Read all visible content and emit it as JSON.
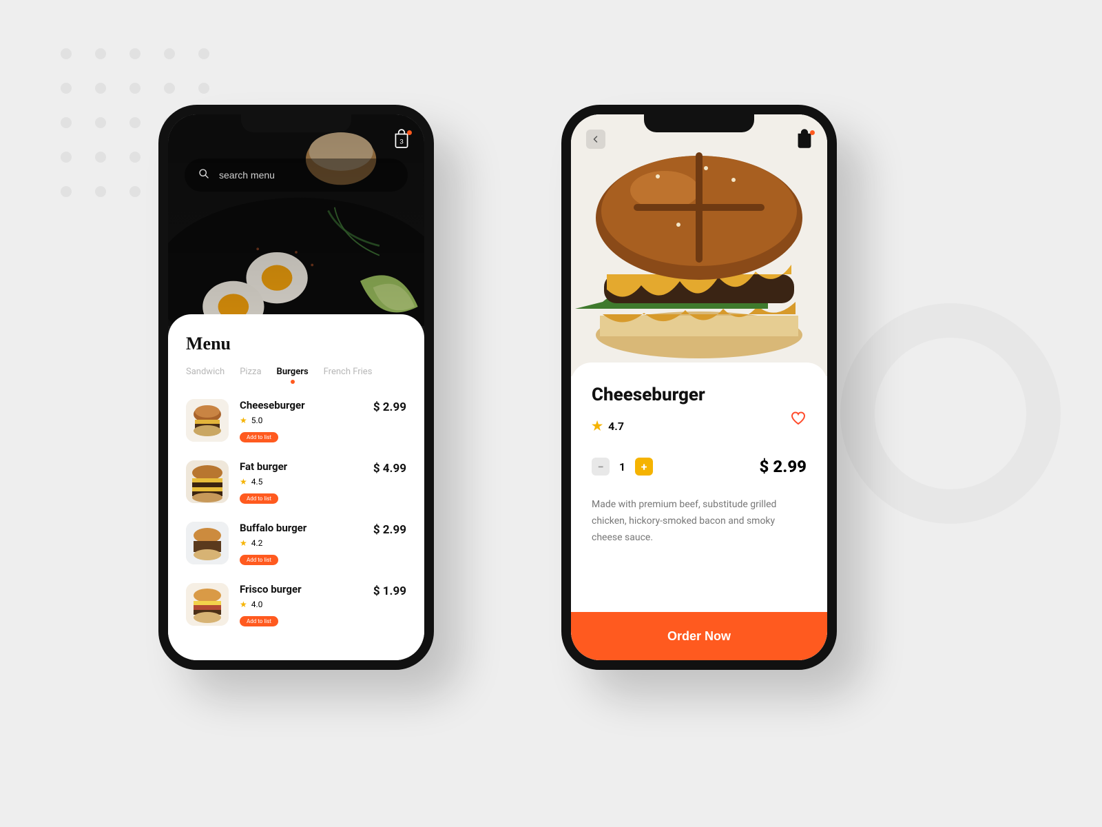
{
  "cart": {
    "count": "3"
  },
  "menu": {
    "title": "Menu",
    "search_placeholder": "search menu",
    "tabs": [
      "Sandwich",
      "Pizza",
      "Burgers",
      "French Fries"
    ],
    "active_tab_index": 2,
    "add_label": "Add to list",
    "items": [
      {
        "name": "Cheeseburger",
        "rating": "5.0",
        "price": "$ 2.99"
      },
      {
        "name": "Fat burger",
        "rating": "4.5",
        "price": "$ 4.99"
      },
      {
        "name": "Buffalo burger",
        "rating": "4.2",
        "price": "$ 2.99"
      },
      {
        "name": "Frisco burger",
        "rating": "4.0",
        "price": "$ 1.99"
      }
    ]
  },
  "detail": {
    "title": "Cheeseburger",
    "rating": "4.7",
    "qty": "1",
    "price": "$ 2.99",
    "description": "Made with premium beef, substitude grilled chicken, hickory-smoked bacon and smoky cheese sauce.",
    "order_label": "Order Now"
  }
}
